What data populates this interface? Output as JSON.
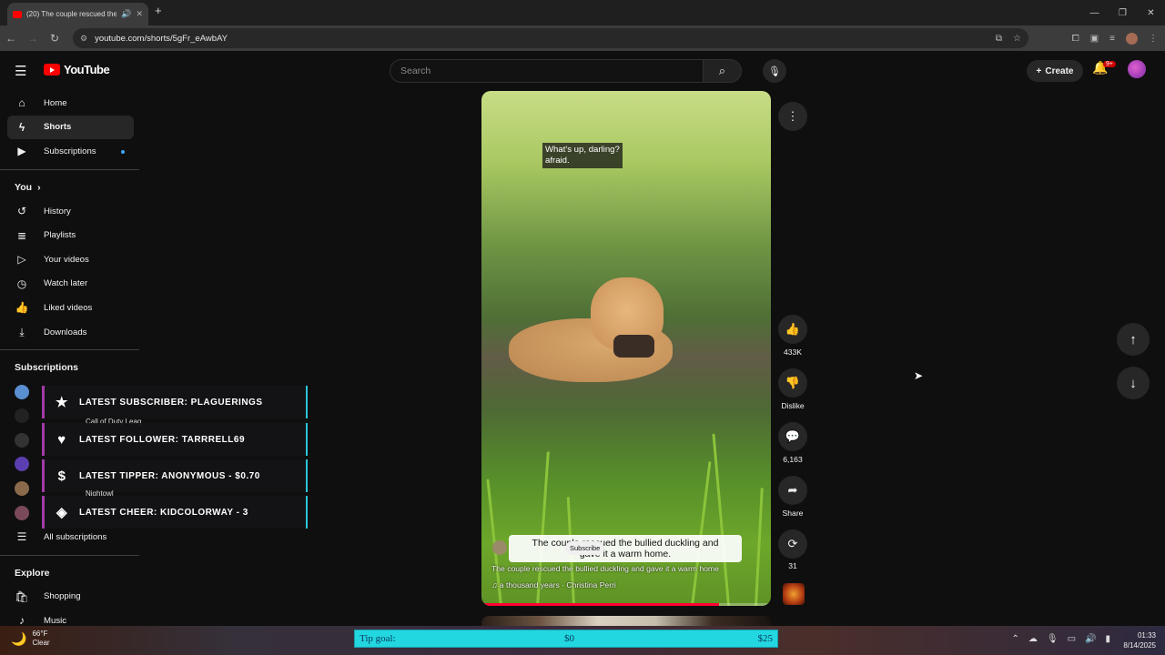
{
  "browser": {
    "tab_title": "(20) The couple rescued the",
    "url": "youtube.com/shorts/5gFr_eAwbAY"
  },
  "header": {
    "logo_text": "YouTube",
    "search_placeholder": "Search",
    "create_label": "Create",
    "notification_count": "9+"
  },
  "sidebar": {
    "main": [
      {
        "label": "Home",
        "icon": "home-icon"
      },
      {
        "label": "Shorts",
        "icon": "shorts-icon"
      },
      {
        "label": "Subscriptions",
        "icon": "subscriptions-icon"
      }
    ],
    "you_title": "You",
    "you_items": [
      {
        "label": "History"
      },
      {
        "label": "Playlists"
      },
      {
        "label": "Your videos"
      },
      {
        "label": "Watch later"
      },
      {
        "label": "Liked videos"
      },
      {
        "label": "Downloads"
      }
    ],
    "subscriptions_title": "Subscriptions",
    "subscriptions_peek": [
      "Call of Duty Leag",
      "Nightowl"
    ],
    "all_subscriptions": "All subscriptions",
    "explore_title": "Explore",
    "explore_items": [
      {
        "label": "Shopping"
      },
      {
        "label": "Music"
      }
    ]
  },
  "overlay": {
    "subscriber": "LATEST SUBSCRIBER: PLAGUERINGS",
    "follower": "LATEST FOLLOWER: TARRRELL69",
    "tipper": "LATEST TIPPER: ANONYMOUS - $0.70",
    "cheer": "LATEST CHEER: KIDCOLORWAY - 3"
  },
  "video": {
    "caption_line1": "What's up, darling?",
    "caption_line2": "afraid.",
    "title_overlay_line1": "The couple rescued the bullied duckling and",
    "title_overlay_line2": "gave it a warm home.",
    "subscribe": "Subscribe",
    "description": "The couple rescued the bullied duckling and gave it a warm home",
    "music": "♫  a thousand years · Christina Perri",
    "progress": 0.82
  },
  "actions": {
    "likes": "433K",
    "dislike": "Dislike",
    "comments": "6,163",
    "share": "Share",
    "remix": "31"
  },
  "taskbar": {
    "temp": "66°F",
    "cond": "Clear",
    "tip_label": "Tip goal:",
    "tip_current": "$0",
    "tip_goal": "$25",
    "time": "01:33",
    "date": "8/14/2025"
  }
}
